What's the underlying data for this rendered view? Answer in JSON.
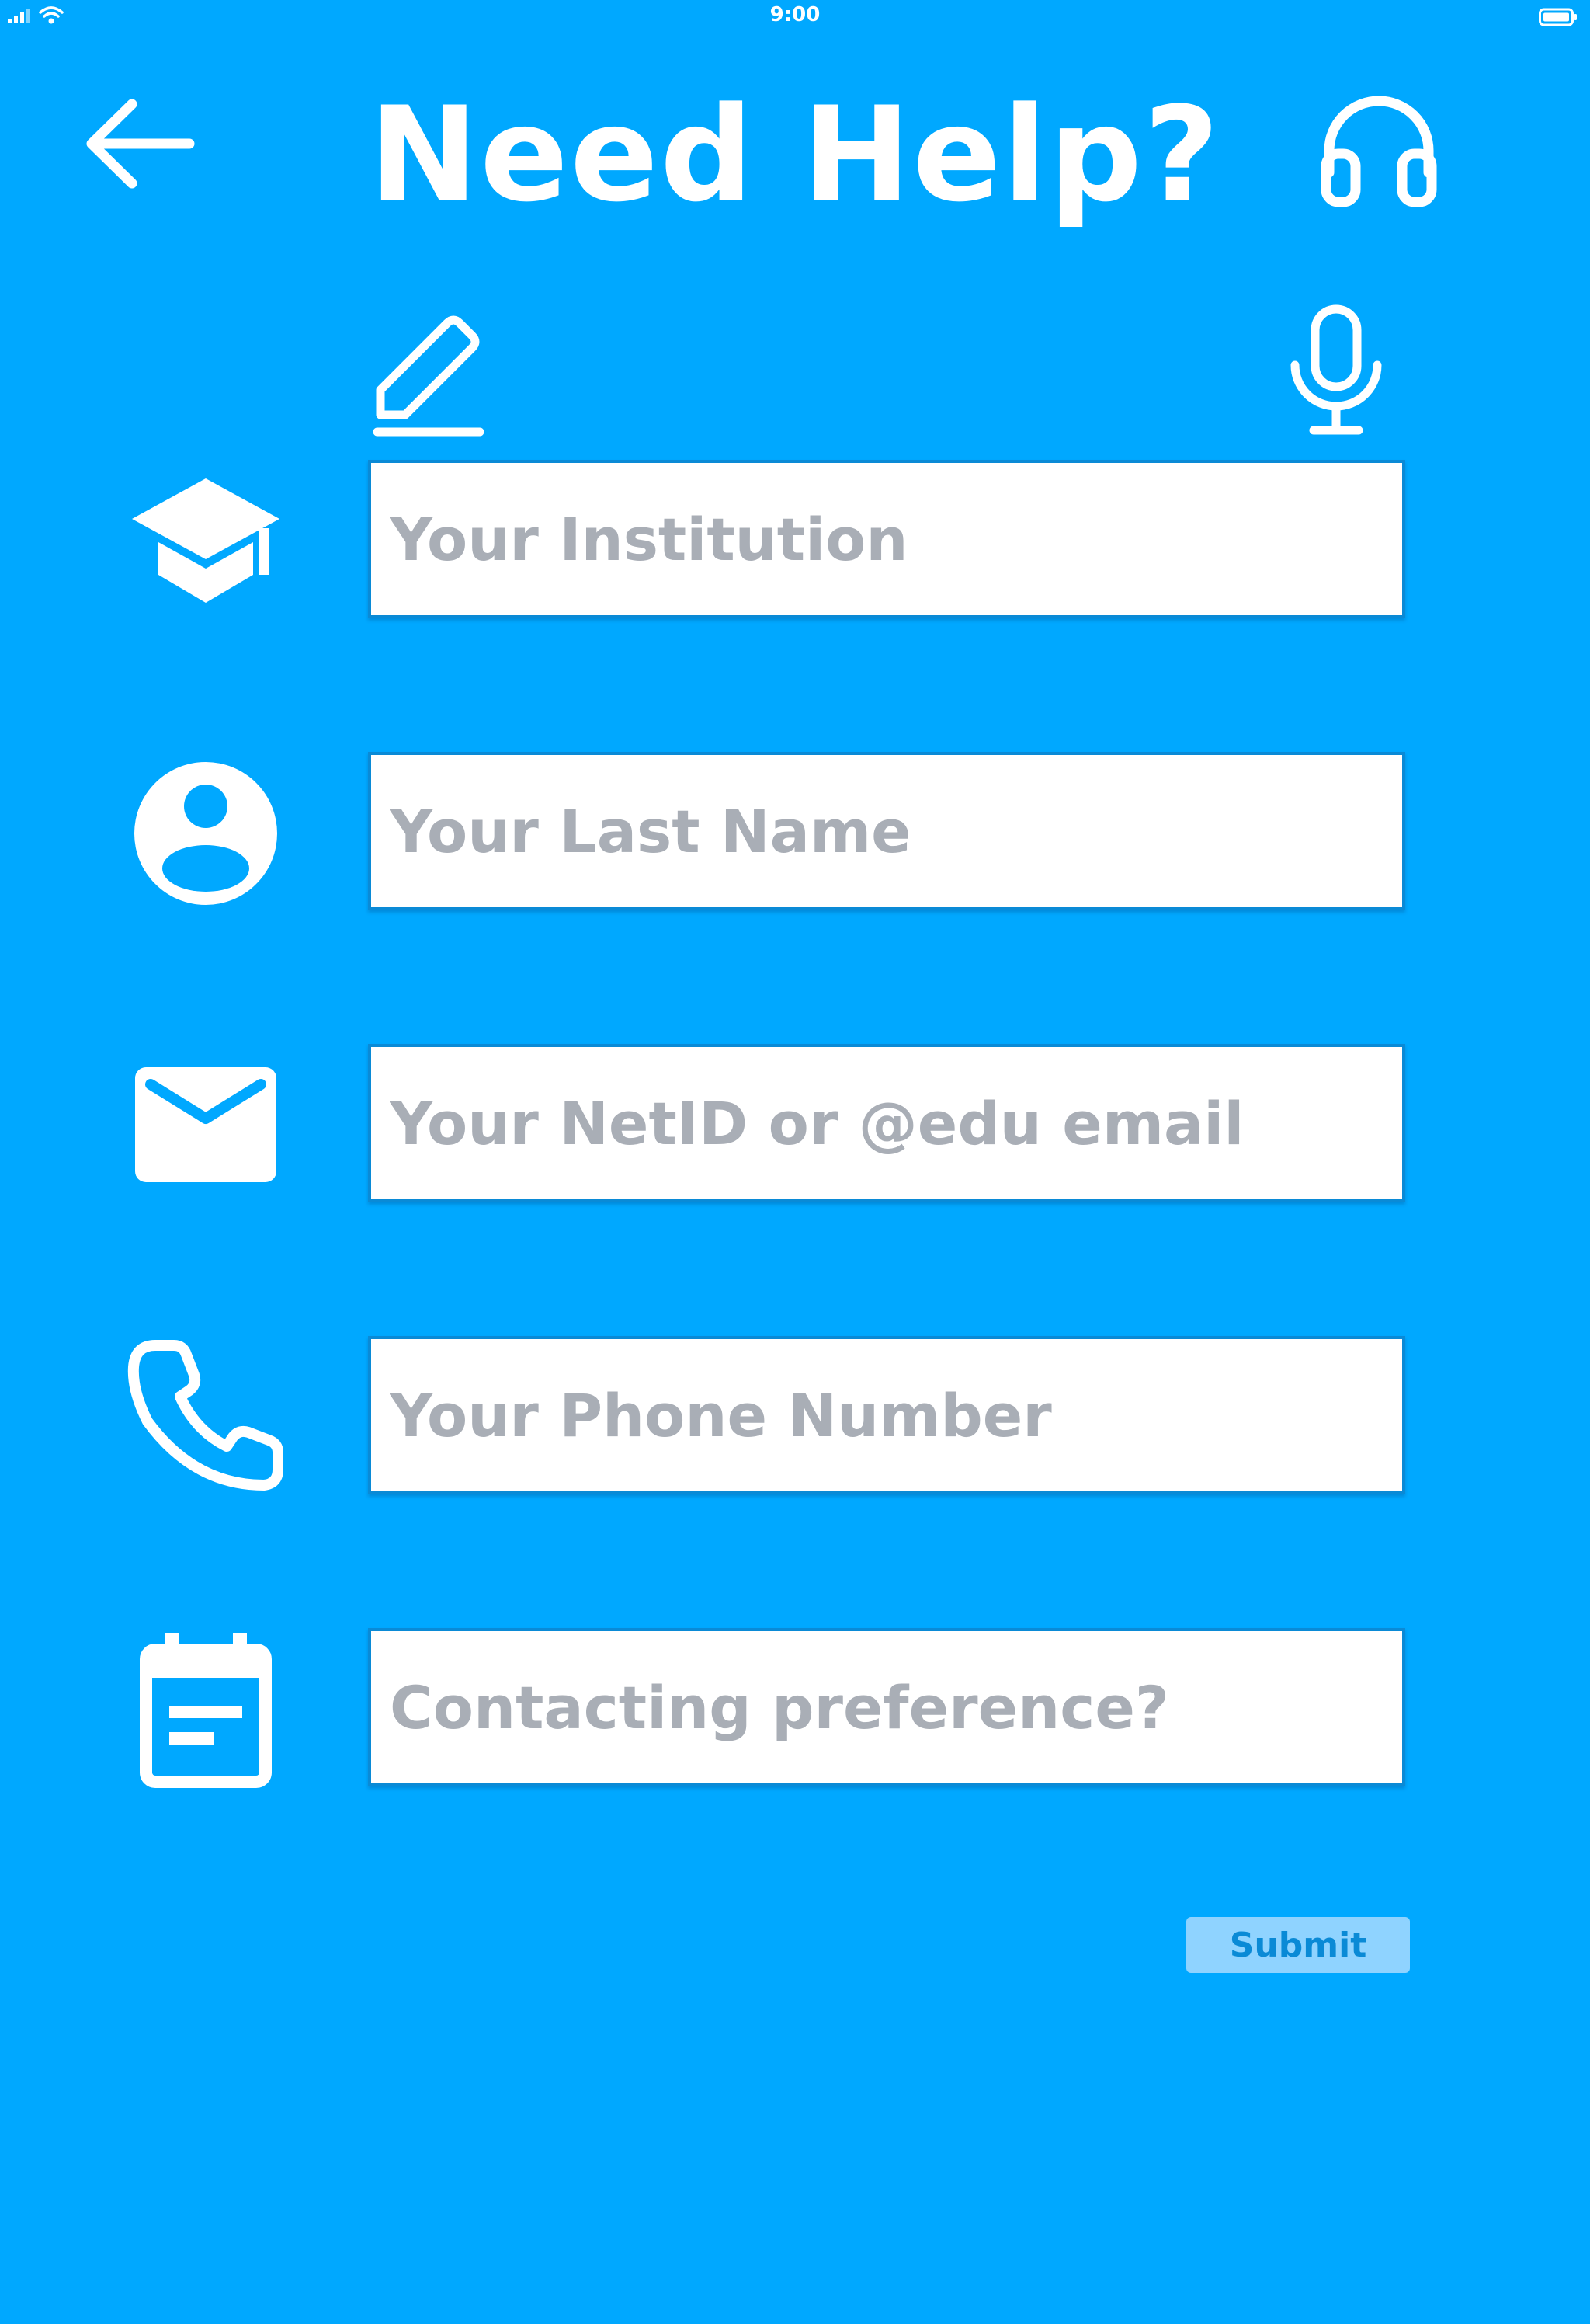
{
  "status_bar": {
    "time": "9:00"
  },
  "header": {
    "title": "Need Help?",
    "back_icon": "arrow-left-icon",
    "support_icon": "headset-icon"
  },
  "input_modes": {
    "text_icon": "pencil-icon",
    "voice_icon": "microphone-icon"
  },
  "form": {
    "fields": [
      {
        "icon": "graduation-cap-icon",
        "placeholder": "Your Institution",
        "value": ""
      },
      {
        "icon": "user-circle-icon",
        "placeholder": "Your Last Name",
        "value": ""
      },
      {
        "icon": "envelope-icon",
        "placeholder": "Your NetID or @edu email",
        "value": ""
      },
      {
        "icon": "phone-icon",
        "placeholder": "Your Phone Number",
        "value": ""
      },
      {
        "icon": "calendar-icon",
        "placeholder": "Contacting preference?",
        "value": ""
      }
    ],
    "submit_label": "Submit"
  },
  "colors": {
    "background": "#00a8ff",
    "icon": "#ffffff",
    "field_border": "#0a8ad6",
    "placeholder": "#a9aeb6",
    "submit_background": "#8fd3ff",
    "submit_text": "#0a8ad6"
  }
}
